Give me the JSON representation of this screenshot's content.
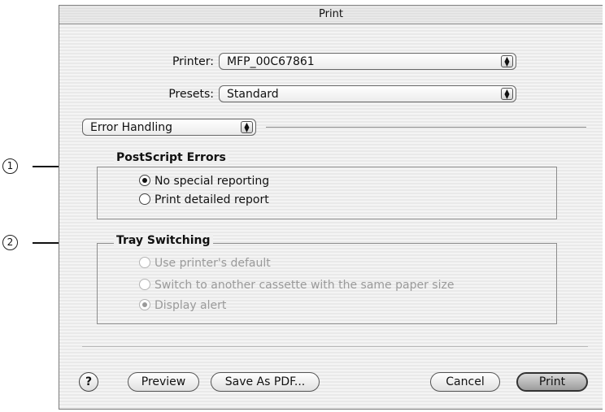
{
  "window": {
    "title": "Print"
  },
  "printer": {
    "label": "Printer:",
    "value": "MFP_00C67861"
  },
  "presets": {
    "label": "Presets:",
    "value": "Standard"
  },
  "panel_selector": {
    "value": "Error Handling"
  },
  "callouts": [
    "1",
    "2"
  ],
  "postscript_errors": {
    "title": "PostScript Errors",
    "options": [
      {
        "label": "No special reporting",
        "checked": true
      },
      {
        "label": "Print detailed report",
        "checked": false
      }
    ]
  },
  "tray_switching": {
    "title": "Tray Switching",
    "options": [
      {
        "label": "Use printer's default",
        "checked": false
      },
      {
        "label": "Switch to another cassette with the same paper size",
        "checked": false
      },
      {
        "label": "Display alert",
        "checked": true
      }
    ]
  },
  "buttons": {
    "help": "?",
    "preview": "Preview",
    "save_pdf": "Save As PDF...",
    "cancel": "Cancel",
    "print": "Print"
  }
}
